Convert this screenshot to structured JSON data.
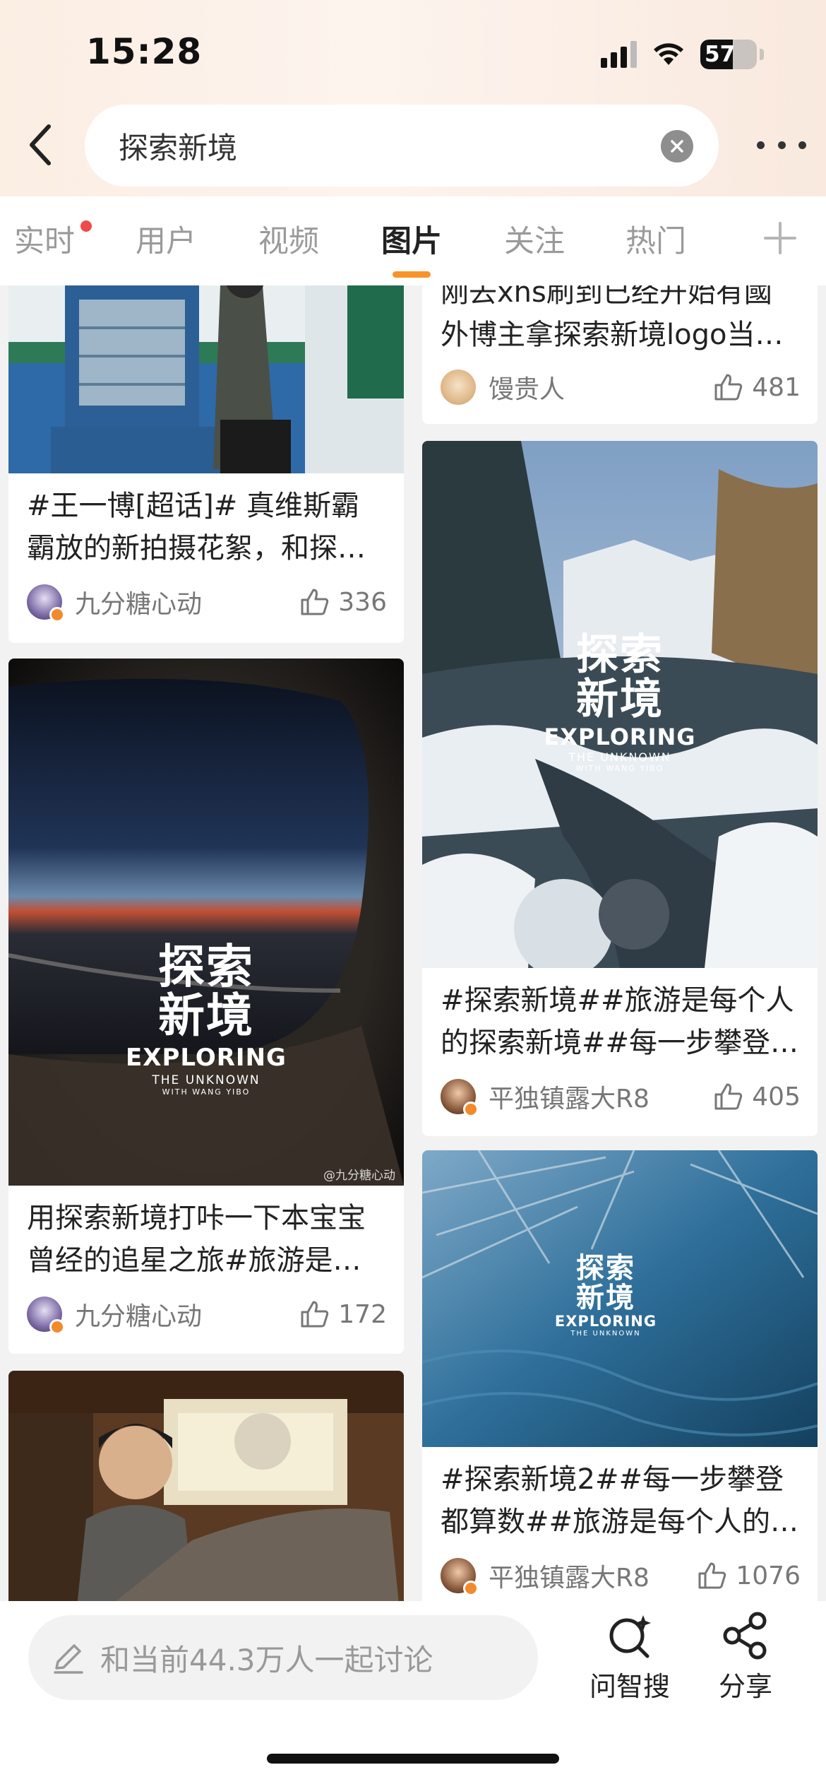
{
  "status_bar": {
    "time": "15:28",
    "battery": "57",
    "battery_level": 0.57
  },
  "search": {
    "query": "探索新境"
  },
  "tabs": [
    {
      "label": "实时",
      "has_dot": true
    },
    {
      "label": "用户"
    },
    {
      "label": "视频"
    },
    {
      "label": "图片",
      "active": true
    },
    {
      "label": "关注"
    },
    {
      "label": "热门"
    }
  ],
  "cards": {
    "c1": {
      "title_line1": "#王一博[超话]#  真维斯霸",
      "title_line2": "霸放的新拍摄花絮，和探…",
      "author": "九分糖心动",
      "likes": "336"
    },
    "c2": {
      "title_line1": "用探索新境打咔一下本宝宝",
      "title_line2": "曾经的追星之旅#旅游是…",
      "author": "九分糖心动",
      "likes": "172",
      "overlay": {
        "cn1": "探索",
        "cn2": "新境",
        "en": "EXPLORING",
        "sub1": "THE UNKNOWN",
        "sub2": "WITH WANG YIBO"
      },
      "watermark": "@九分糖心动"
    },
    "c3": {},
    "r1": {
      "title_line1": "刚去xhs刷到已经开始有國",
      "title_line2": "外博主拿探索新境logo当…",
      "author": "馒贵人",
      "likes": "481"
    },
    "r2": {
      "title_line1": "#探索新境##旅游是每个人",
      "title_line2": "的探索新境##每一步攀登…",
      "author": "平独镇露大R8",
      "likes": "405",
      "overlay": {
        "cn1": "探索",
        "cn2": "新境",
        "en": "EXPLORING",
        "sub1": "THE UNKNOWN",
        "sub2": "WITH WANG YIBO"
      }
    },
    "r3": {
      "title_line1": "#探索新境2##每一步攀登",
      "title_line2": "都算数##旅游是每个人的…",
      "author": "平独镇露大R8",
      "likes": "1076",
      "overlay": {
        "cn1": "探索",
        "cn2": "新境",
        "en": "EXPLORING",
        "sub1": "THE UNKNOWN"
      }
    }
  },
  "bottom_bar": {
    "discuss_placeholder": "和当前44.3万人一起讨论",
    "ask_label": "问智搜",
    "share_label": "分享"
  },
  "icons": {
    "back": "chevron-left-icon",
    "clear": "clear-icon",
    "more": "more-icon",
    "like": "thumbs-up-icon",
    "pencil": "pencil-icon",
    "ask": "ai-search-icon",
    "share": "share-icon",
    "add": "plus-icon"
  },
  "colors": {
    "accent": "#f7932a",
    "dot": "#ef4a4a",
    "verified": "#f28a2c"
  }
}
